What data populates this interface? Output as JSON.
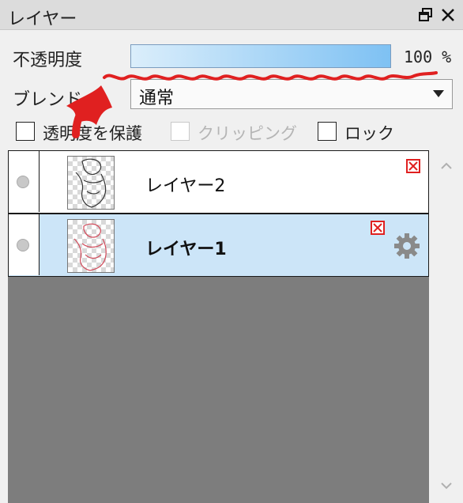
{
  "panel": {
    "title": "レイヤー"
  },
  "opacity": {
    "label": "不透明度",
    "value_text": "100 %",
    "value": 100
  },
  "blend": {
    "label": "ブレンド",
    "selected": "通常"
  },
  "options": [
    {
      "label": "透明度を保護",
      "checked": false,
      "enabled": true
    },
    {
      "label": "クリッピング",
      "checked": false,
      "enabled": false
    },
    {
      "label": "ロック",
      "checked": false,
      "enabled": true
    }
  ],
  "layers": [
    {
      "name": "レイヤー2",
      "visible": true,
      "selected": false
    },
    {
      "name": "レイヤー1",
      "visible": true,
      "selected": true
    }
  ],
  "colors": {
    "accent": "#cce5f8",
    "annotation": "#e02020",
    "list_bg": "#7d7d7d"
  },
  "icons": {
    "restore": "restore-window-icon",
    "close": "close-icon",
    "mask": "mask-icon",
    "gear": "gear-icon"
  }
}
